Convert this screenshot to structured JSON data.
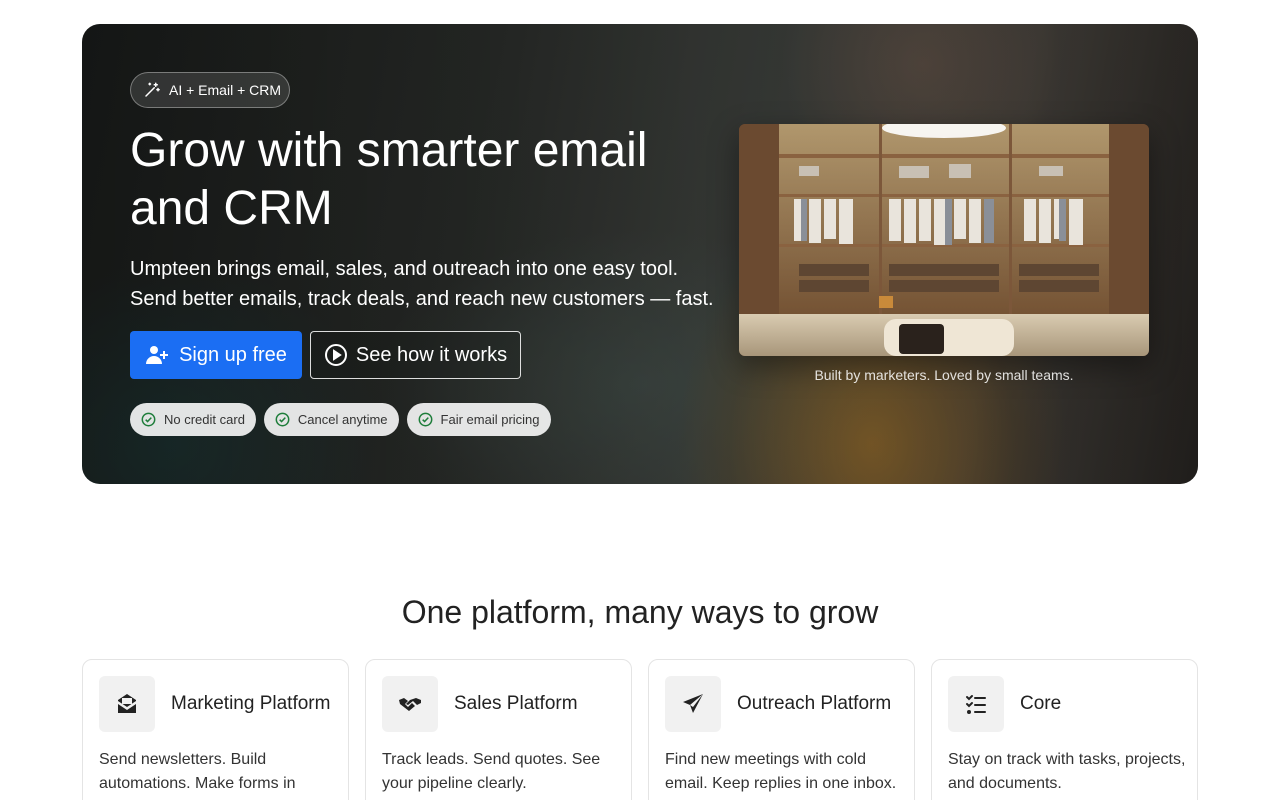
{
  "hero": {
    "pill_label": "AI + Email + CRM",
    "title": "Grow with smarter email and CRM",
    "subtitle_line1": "Umpteen brings email, sales, and outreach into one easy tool.",
    "subtitle_line2": "Send better emails, track deals, and reach new customers — fast.",
    "primary_button": "Sign up free",
    "secondary_button": "See how it works",
    "badges": [
      "No credit card",
      "Cancel anytime",
      "Fair email pricing"
    ],
    "image_caption": "Built by marketers. Loved by small teams."
  },
  "features": {
    "title": "One platform, many ways to grow",
    "cards": [
      {
        "title": "Marketing Platform",
        "desc": "Send newsletters. Build automations. Make forms in",
        "icon": "envelope-open-icon"
      },
      {
        "title": "Sales Platform",
        "desc": "Track leads. Send quotes. See your pipeline clearly.",
        "icon": "handshake-icon"
      },
      {
        "title": "Outreach Platform",
        "desc": "Find new meetings with cold email. Keep replies in one inbox.",
        "icon": "paper-plane-icon"
      },
      {
        "title": "Core",
        "desc": "Stay on track with tasks, projects, and documents.",
        "icon": "checklist-icon"
      }
    ]
  },
  "colors": {
    "primary": "#1b6ef3",
    "badge_check": "#1e7d3a"
  }
}
